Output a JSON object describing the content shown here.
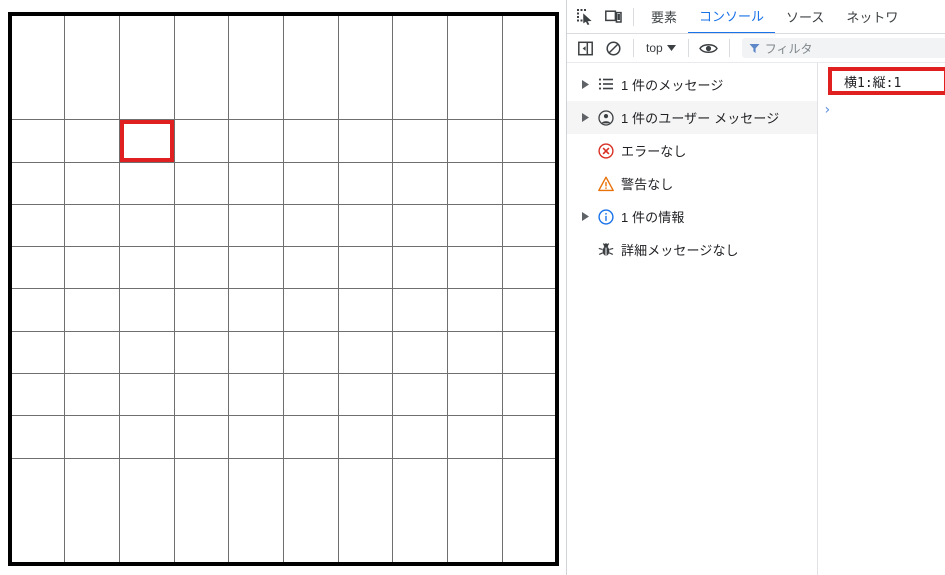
{
  "page": {
    "grid": {
      "columns": 10,
      "rows": 10,
      "selected_cell": {
        "col": 2,
        "row": 1
      },
      "selected_color": "#e02020",
      "line_color": "#6f6f6f",
      "border_color": "#000000"
    }
  },
  "devtools": {
    "accent_color": "#1a73e8",
    "tabbar": {
      "inspect_icon": "inspect-element-icon",
      "device_icon": "device-toolbar-icon",
      "tabs": [
        {
          "label": "要素",
          "active": false
        },
        {
          "label": "コンソール",
          "active": true
        },
        {
          "label": "ソース",
          "active": false
        },
        {
          "label": "ネットワ",
          "active": false
        }
      ]
    },
    "toolbar": {
      "sidebar_toggle_icon": "console-sidebar-toggle-icon",
      "clear_icon": "clear-console-icon",
      "context_label": "top",
      "context_caret_icon": "chevron-down-icon",
      "eye_icon": "live-expression-eye-icon",
      "filter_icon": "filter-icon",
      "filter_placeholder": "フィルタ",
      "filter_value": ""
    },
    "sidebar": {
      "items": [
        {
          "label": "1 件のメッセージ",
          "icon": "all-messages-icon",
          "expandable": true,
          "hovered": false
        },
        {
          "label": "1 件のユーザー メッセージ",
          "icon": "user-message-icon",
          "expandable": true,
          "hovered": true
        },
        {
          "label": "エラーなし",
          "icon": "error-icon",
          "expandable": false,
          "hovered": false
        },
        {
          "label": "警告なし",
          "icon": "warning-icon",
          "expandable": false,
          "hovered": false
        },
        {
          "label": "1 件の情報",
          "icon": "info-icon",
          "expandable": true,
          "hovered": false
        },
        {
          "label": "詳細メッセージなし",
          "icon": "verbose-bug-icon",
          "expandable": false,
          "hovered": false
        }
      ]
    },
    "output": {
      "log_text": "横1:縦:1",
      "prompt_caret": "❯",
      "annotation_color": "#e02020"
    }
  }
}
